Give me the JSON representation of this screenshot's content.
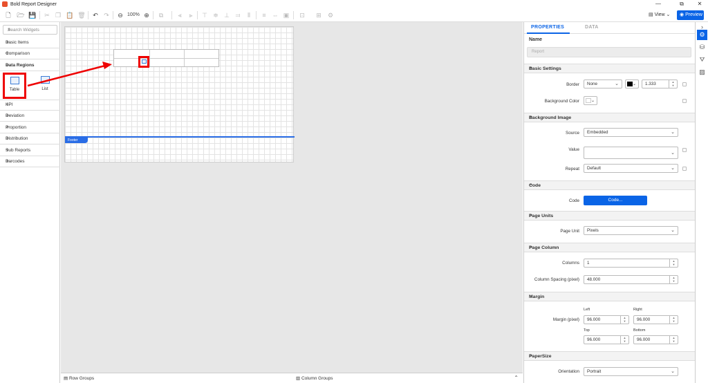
{
  "app": {
    "title": "Bold Report Designer"
  },
  "window_controls": {
    "minimize": "—",
    "maximize": "⧉",
    "close": "✕"
  },
  "toolbar": {
    "zoom": "100%",
    "view_label": "View",
    "preview_label": "Preview"
  },
  "left_panel": {
    "search_placeholder": "Search Widgets",
    "categories_top": [
      "Basic Items",
      "Comparison"
    ],
    "data_regions_label": "Data Regions",
    "widgets": [
      "Table",
      "List"
    ],
    "categories_bottom": [
      "KPI",
      "Deviation",
      "Proportion",
      "Distribution",
      "Sub Reports",
      "Barcodes"
    ]
  },
  "canvas": {
    "footer_label": "Footer"
  },
  "bottom_bar": {
    "row_groups": "Row Groups",
    "column_groups": "Column Groups"
  },
  "properties": {
    "tab_properties": "PROPERTIES",
    "tab_data": "DATA",
    "name_label": "Name",
    "name_value": "Report",
    "sections": {
      "basic_settings": "Basic Settings",
      "background_image": "Background Image",
      "code": "Code",
      "page_units": "Page Units",
      "page_column": "Page Column",
      "margin": "Margin",
      "paper_size": "PaperSize"
    },
    "border_label": "Border",
    "border_style": "None",
    "border_width": "1.333",
    "background_color_label": "Background Color",
    "source_label": "Source",
    "source_value": "Embedded",
    "value_label": "Value",
    "value_value": "",
    "repeat_label": "Repeat",
    "repeat_value": "Default",
    "code_label": "Code",
    "code_button": "Code...",
    "page_unit_label": "Page Unit",
    "page_unit_value": "Pixels",
    "columns_label": "Columns",
    "columns_value": "1",
    "column_spacing_label": "Column Spacing (pixel)",
    "column_spacing_value": "48.000",
    "margin_label": "Margin (pixel)",
    "margin_left_label": "Left",
    "margin_left": "96.000",
    "margin_right_label": "Right",
    "margin_right": "96.000",
    "margin_top_label": "Top",
    "margin_top": "96.000",
    "margin_bottom_label": "Bottom",
    "margin_bottom": "96.000",
    "orientation_label": "Orientation",
    "orientation_value": "Portrait"
  },
  "colors": {
    "accent": "#0a64e6",
    "highlight": "#ee0000",
    "footer": "#2a6de6"
  }
}
